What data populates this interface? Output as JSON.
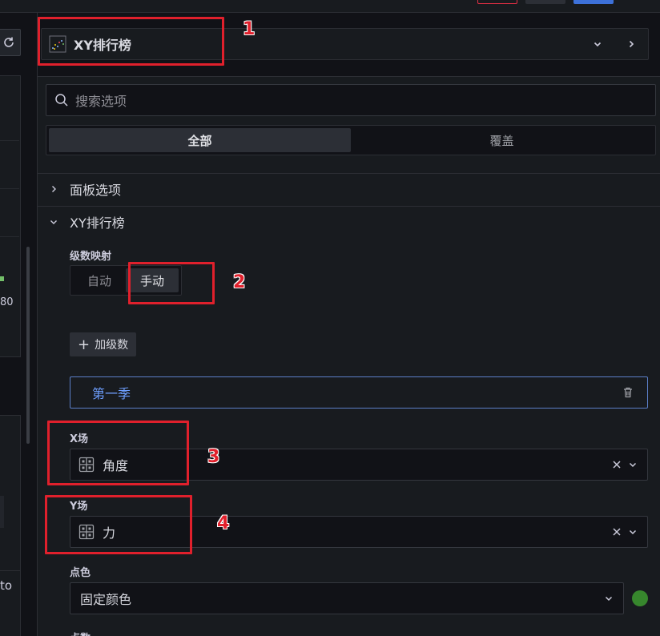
{
  "top_bar": {
    "buttons": [
      {
        "name": "discard",
        "color": "#e02f44"
      },
      {
        "name": "save",
        "color": "#3d71d9"
      }
    ]
  },
  "preview": {
    "tick_label": "80",
    "auto_text": "to"
  },
  "viz_picker": {
    "title": "XY排行榜",
    "icon": "xy-chart-icon"
  },
  "options": {
    "search_placeholder": "搜索选项",
    "tabs": [
      {
        "label": "全部",
        "active": true
      },
      {
        "label": "覆盖",
        "active": false
      }
    ],
    "sections": {
      "panel_options": "面板选项",
      "xy_chart": "XY排行榜"
    },
    "series_mapping": {
      "label": "级数映射",
      "options": [
        {
          "label": "自动",
          "active": false
        },
        {
          "label": "手动",
          "active": true
        }
      ]
    },
    "add_series_label": "加级数",
    "series": [
      {
        "name": "第一季"
      }
    ],
    "x_field": {
      "label": "X场",
      "value": "角度"
    },
    "y_field": {
      "label": "Y场",
      "value": "力"
    },
    "point_color": {
      "label": "点色",
      "value": "固定颜色",
      "swatch": "#37872d"
    },
    "next_label": "点数"
  },
  "annotations": [
    "1",
    "2",
    "3",
    "4"
  ]
}
